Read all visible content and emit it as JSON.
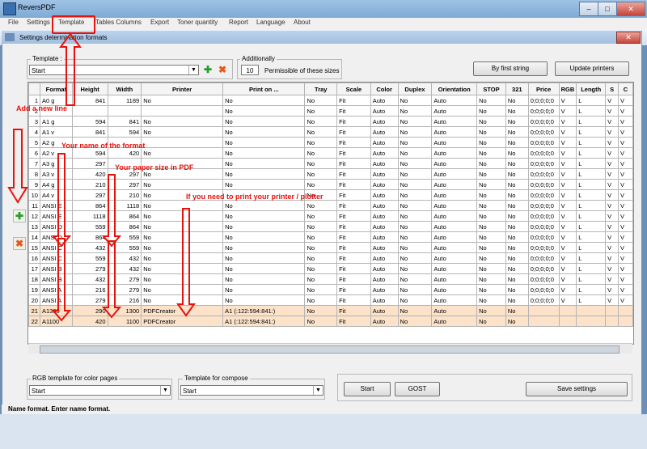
{
  "app": {
    "title": "ReversPDF",
    "menu": [
      "File",
      "Settings",
      "Template",
      "Tables Columns",
      "Export",
      "Toner quantity",
      "Report",
      "Language",
      "About"
    ]
  },
  "dialog": {
    "title": "Settings determination formats",
    "template_label": "Template :",
    "template_value": "Start",
    "additionally_label": "Additionally",
    "permissible_value": "10",
    "permissible_label": "Permissible of these sizes",
    "by_first_string": "By first string",
    "update_printers": "Update printers",
    "rgb_label": "RGB template for color pages",
    "rgb_value": "Start",
    "compose_label": "Template for compose",
    "compose_value": "Start",
    "start_button": "Start",
    "gost_button": "GOST",
    "save_settings": "Save settings",
    "status": "Name format. Enter name format."
  },
  "grid": {
    "columns": [
      "",
      "Format",
      "Height",
      "Width",
      "Printer",
      "Print on ...",
      "Tray",
      "Scale",
      "Color",
      "Duplex",
      "Orientation",
      "STOP",
      "321",
      "Price",
      "RGB",
      "Length",
      "S",
      "C"
    ],
    "rows": [
      [
        "1",
        "A0 g",
        "841",
        "1189",
        "No",
        "No",
        "No",
        "Fit",
        "Auto",
        "No",
        "Auto",
        "No",
        "No",
        "0;0;0;0;0",
        "V",
        "L",
        "V",
        "V"
      ],
      [
        "2",
        "",
        "",
        "",
        "",
        "No",
        "No",
        "Fit",
        "Auto",
        "No",
        "Auto",
        "No",
        "No",
        "0;0;0;0;0",
        "V",
        "L",
        "V",
        "V"
      ],
      [
        "3",
        "A1 g",
        "594",
        "841",
        "No",
        "No",
        "No",
        "Fit",
        "Auto",
        "No",
        "Auto",
        "No",
        "No",
        "0;0;0;0;0",
        "V",
        "L",
        "V",
        "V"
      ],
      [
        "4",
        "A1 v",
        "841",
        "594",
        "No",
        "No",
        "No",
        "Fit",
        "Auto",
        "No",
        "Auto",
        "No",
        "No",
        "0;0;0;0;0",
        "V",
        "L",
        "V",
        "V"
      ],
      [
        "5",
        "A2 g",
        "",
        "",
        "",
        "No",
        "No",
        "Fit",
        "Auto",
        "No",
        "Auto",
        "No",
        "No",
        "0;0;0;0;0",
        "V",
        "L",
        "V",
        "V"
      ],
      [
        "6",
        "A2 v",
        "594",
        "420",
        "No",
        "No",
        "No",
        "Fit",
        "Auto",
        "No",
        "Auto",
        "No",
        "No",
        "0;0;0;0;0",
        "V",
        "L",
        "V",
        "V"
      ],
      [
        "7",
        "A3 g",
        "297",
        "",
        "",
        "No",
        "No",
        "Fit",
        "Auto",
        "No",
        "Auto",
        "No",
        "No",
        "0;0;0;0;0",
        "V",
        "L",
        "V",
        "V"
      ],
      [
        "8",
        "A3 v",
        "420",
        "297",
        "No",
        "No",
        "No",
        "Fit",
        "Auto",
        "No",
        "Auto",
        "No",
        "No",
        "0;0;0;0;0",
        "V",
        "L",
        "V",
        "V"
      ],
      [
        "9",
        "A4 g",
        "210",
        "297",
        "No",
        "No",
        "No",
        "Fit",
        "Auto",
        "No",
        "Auto",
        "No",
        "No",
        "0;0;0;0;0",
        "V",
        "L",
        "V",
        "V"
      ],
      [
        "10",
        "A4 v",
        "297",
        "210",
        "No",
        "",
        "No",
        "Fit",
        "Auto",
        "No",
        "Auto",
        "No",
        "No",
        "0;0;0;0;0",
        "V",
        "L",
        "V",
        "V"
      ],
      [
        "11",
        "ANSI E",
        "864",
        "1118",
        "No",
        "No",
        "No",
        "Fit",
        "Auto",
        "No",
        "Auto",
        "No",
        "No",
        "0;0;0;0;0",
        "V",
        "L",
        "V",
        "V"
      ],
      [
        "12",
        "ANSI E",
        "1118",
        "864",
        "No",
        "No",
        "No",
        "Fit",
        "Auto",
        "No",
        "Auto",
        "No",
        "No",
        "0;0;0;0;0",
        "V",
        "L",
        "V",
        "V"
      ],
      [
        "13",
        "ANSI D",
        "559",
        "864",
        "No",
        "No",
        "No",
        "Fit",
        "Auto",
        "No",
        "Auto",
        "No",
        "No",
        "0;0;0;0;0",
        "V",
        "L",
        "V",
        "V"
      ],
      [
        "14",
        "ANSI D",
        "864",
        "559",
        "No",
        "No",
        "No",
        "Fit",
        "Auto",
        "No",
        "Auto",
        "No",
        "No",
        "0;0;0;0;0",
        "V",
        "L",
        "V",
        "V"
      ],
      [
        "15",
        "ANSI C",
        "432",
        "559",
        "No",
        "No",
        "No",
        "Fit",
        "Auto",
        "No",
        "Auto",
        "No",
        "No",
        "0;0;0;0;0",
        "V",
        "L",
        "V",
        "V"
      ],
      [
        "16",
        "ANSI C",
        "559",
        "432",
        "No",
        "No",
        "No",
        "Fit",
        "Auto",
        "No",
        "Auto",
        "No",
        "No",
        "0;0;0;0;0",
        "V",
        "L",
        "V",
        "V"
      ],
      [
        "17",
        "ANSI B",
        "279",
        "432",
        "No",
        "No",
        "No",
        "Fit",
        "Auto",
        "No",
        "Auto",
        "No",
        "No",
        "0;0;0;0;0",
        "V",
        "L",
        "V",
        "V"
      ],
      [
        "18",
        "ANSI B",
        "432",
        "279",
        "No",
        "No",
        "No",
        "Fit",
        "Auto",
        "No",
        "Auto",
        "No",
        "No",
        "0;0;0;0;0",
        "V",
        "L",
        "V",
        "V"
      ],
      [
        "19",
        "ANSI A",
        "216",
        "279",
        "No",
        "No",
        "No",
        "Fit",
        "Auto",
        "No",
        "Auto",
        "No",
        "No",
        "0;0;0;0;0",
        "V",
        "L",
        "V",
        "V"
      ],
      [
        "20",
        "ANSI A",
        "279",
        "216",
        "No",
        "No",
        "No",
        "Fit",
        "Auto",
        "No",
        "Auto",
        "No",
        "No",
        "0;0;0;0;0",
        "V",
        "L",
        "V",
        "V"
      ],
      [
        "21",
        "A1300",
        "290",
        "1300",
        "PDFCreator",
        "A1 (:122:594:841:)",
        "No",
        "Fit",
        "Auto",
        "No",
        "Auto",
        "No",
        "No",
        "",
        "",
        "",
        "",
        ""
      ],
      [
        "22",
        "A1100",
        "420",
        "1100",
        "PDFCreator",
        "A1 (:122:594:841:)",
        "No",
        "Fit",
        "Auto",
        "No",
        "Auto",
        "No",
        "No",
        "",
        "",
        "",
        "",
        ""
      ]
    ],
    "selected_rows": [
      20,
      21
    ]
  },
  "annotations": {
    "add_line": "Add a new line",
    "name_format": "Your name of the format",
    "paper_size": "Your paper size in PDF",
    "printer": "If you need to print your printer / plotter",
    "color": "#e8120c"
  },
  "icons": [
    "app-icon",
    "plus-icon",
    "cross-icon",
    "chevron-down-icon",
    "close-icon"
  ]
}
